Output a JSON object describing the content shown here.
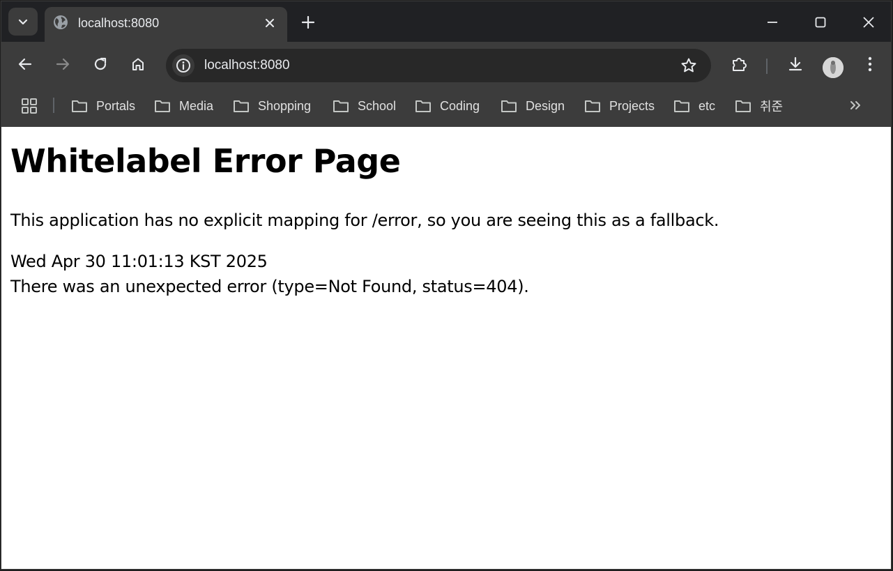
{
  "tab": {
    "title": "localhost:8080"
  },
  "omnibox": {
    "url": "localhost:8080"
  },
  "bookmarks": [
    {
      "label": "Portals"
    },
    {
      "label": "Media"
    },
    {
      "label": "Shopping"
    },
    {
      "label": "School"
    },
    {
      "label": "Coding"
    },
    {
      "label": "Design"
    },
    {
      "label": "Projects"
    },
    {
      "label": "etc"
    },
    {
      "label": "취준"
    }
  ],
  "page": {
    "heading": "Whitelabel Error Page",
    "message": "This application has no explicit mapping for /error, so you are seeing this as a fallback.",
    "timestamp": "Wed Apr 30 11:01:13 KST 2025",
    "error": "There was an unexpected error (type=Not Found, status=404)."
  },
  "icons": {
    "tab_search": "chevron-down-icon",
    "favicon": "globe-icon",
    "tab_close": "close-icon",
    "new_tab": "plus-icon",
    "minimize": "minimize-icon",
    "maximize": "maximize-icon",
    "close_window": "close-icon",
    "back": "arrow-left-icon",
    "forward": "arrow-right-icon",
    "reload": "reload-icon",
    "home": "home-icon",
    "site_info": "info-icon",
    "bookmark_star": "star-icon",
    "extensions": "puzzle-icon",
    "downloads": "download-icon",
    "menu": "more-vert-icon",
    "apps": "apps-grid-icon",
    "folder": "folder-icon",
    "more_bookmarks": "double-chevron-right-icon"
  },
  "colors": {
    "frame": "#202124",
    "toolbar": "#3c3c3c",
    "omnibox": "#282828",
    "page_background": "#ffffff"
  }
}
